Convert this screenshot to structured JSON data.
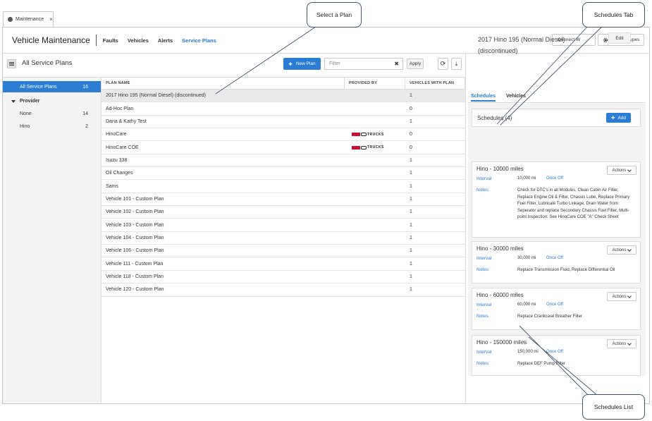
{
  "browser_tab": {
    "label": "Maintenance",
    "close": "×"
  },
  "topnav": {
    "title": "Vehicle Maintenance",
    "links": [
      {
        "label": "Faults",
        "active": false
      },
      {
        "label": "Vehicles",
        "active": false
      },
      {
        "label": "Alerts",
        "active": false
      },
      {
        "label": "Service Plans",
        "active": true
      }
    ],
    "connect_label": "Connect W",
    "service_types_label": "Service Types"
  },
  "left_header": {
    "title": "All Service Plans",
    "new_plan_label": "New Plan",
    "filter_placeholder": "Filter",
    "filter_clear": "✖",
    "apply_label": "Apply",
    "refresh_glyph": "⟳",
    "download_glyph": "⤓"
  },
  "sidebar": {
    "all": {
      "label": "All Service Plans",
      "count": "16"
    },
    "group_label": "Provider",
    "items": [
      {
        "label": "None",
        "count": "14"
      },
      {
        "label": "Hino",
        "count": "2"
      }
    ]
  },
  "table": {
    "columns": [
      "PLAN NAME",
      "PROVIDED BY",
      "VEHICLES WITH PLAN"
    ],
    "provider_logo_text": "TRUCKS",
    "rows": [
      {
        "name": "2017 Hino 195 (Normal Diesel) (discontinued)",
        "logo": false,
        "vehicles": "1"
      },
      {
        "name": "Ad-Hoc Plan",
        "logo": false,
        "vehicles": "0"
      },
      {
        "name": "Dana & Kathy Test",
        "logo": false,
        "vehicles": "1"
      },
      {
        "name": "HinoCare",
        "logo": true,
        "vehicles": "0"
      },
      {
        "name": "HinoCare COE",
        "logo": true,
        "vehicles": "0"
      },
      {
        "name": "Isuzu 338",
        "logo": false,
        "vehicles": "1"
      },
      {
        "name": "Oil Changes",
        "logo": false,
        "vehicles": "1"
      },
      {
        "name": "Sams",
        "logo": false,
        "vehicles": "1"
      },
      {
        "name": "Vehicle 101 - Custom Plan",
        "logo": false,
        "vehicles": "1"
      },
      {
        "name": "Vehicle 102 - Custom Plan",
        "logo": false,
        "vehicles": "1"
      },
      {
        "name": "Vehicle 103 - Custom Plan",
        "logo": false,
        "vehicles": "1"
      },
      {
        "name": "Vehicle 104 - Custom Plan",
        "logo": false,
        "vehicles": "1"
      },
      {
        "name": "Vehicle 106 - Custom Plan",
        "logo": false,
        "vehicles": "1"
      },
      {
        "name": "Vehicle 111 - Custom Plan",
        "logo": false,
        "vehicles": "1"
      },
      {
        "name": "Vehicle 118 - Custom Plan",
        "logo": false,
        "vehicles": "1"
      },
      {
        "name": "Vehicle 120 - Custom Plan",
        "logo": false,
        "vehicles": "1"
      }
    ]
  },
  "detail": {
    "title": "2017 Hino 195 (Normal Diesel) (discontinued)",
    "edit_label": "Edit",
    "tabs": [
      {
        "label": "Schedules",
        "active": true
      },
      {
        "label": "Vehicles",
        "active": false
      }
    ],
    "schedules_header": "Schedules (4)",
    "add_label": "Add",
    "interval_label": "Interval",
    "notes_label": "Notes",
    "actions_label": "Actions",
    "once_off_label": "Once Off",
    "schedules": [
      {
        "title": "Hino - 10000 miles",
        "interval": "10,000 mi",
        "notes": "Check for DTC's in all Modules, Clean Cabin Air Filter, Replace Engine Oil & Filter, Chassis Lube, Replace Primary Fuel Filter, Lubricate Turbo Linkage, Drain Water from Seperator and replace Secondary Chassis Fuel Filter, Multi-point Inspection: See HinoCare COE \"A\" Check Sheet"
      },
      {
        "title": "Hino - 30000 miles",
        "interval": "30,000 mi",
        "notes": "Replace Transmission Fluid, Replace Differential Oil"
      },
      {
        "title": "Hino - 60000 miles",
        "interval": "60,000 mi",
        "notes": "Replace Crankcase Breather Filter"
      },
      {
        "title": "Hino - 150000 miles",
        "interval": "150,000 mi",
        "notes": "Replace DEF Pump Filter"
      }
    ]
  },
  "callouts": {
    "select_plan": "Select a Plan",
    "schedules_tab": "Schedules Tab",
    "schedules_list": "Schedules List"
  },
  "colors": {
    "accent": "#2b7cd3",
    "selected_row": "#e9e9e9",
    "sidebar_bg": "#f3f3f3",
    "logo_red": "#c8102e"
  }
}
